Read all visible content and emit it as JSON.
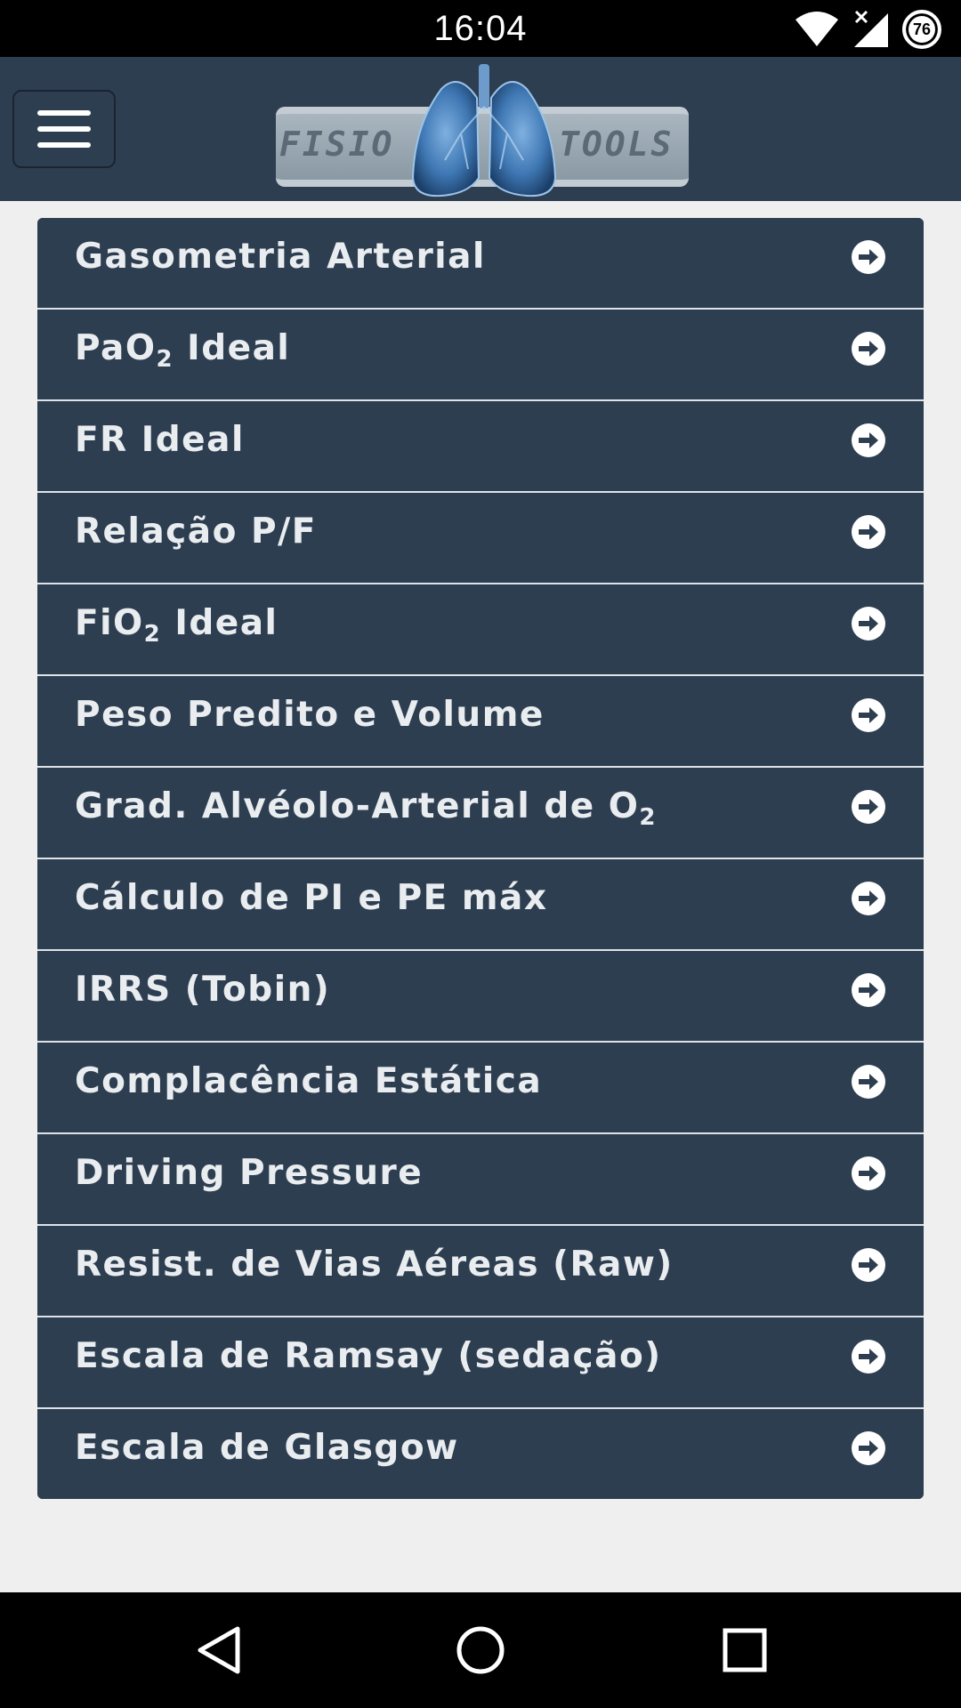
{
  "status_bar": {
    "time": "16:04",
    "battery_level": "76"
  },
  "header": {
    "logo_left": "FISIO",
    "logo_right": "TOOLS"
  },
  "menu": {
    "items": [
      {
        "label": "Gasometria Arterial",
        "sub": "",
        "suffix": ""
      },
      {
        "label": "PaO",
        "sub": "2",
        "suffix": " Ideal"
      },
      {
        "label": "FR Ideal",
        "sub": "",
        "suffix": ""
      },
      {
        "label": "Relação P/F",
        "sub": "",
        "suffix": ""
      },
      {
        "label": "FiO",
        "sub": "2",
        "suffix": " Ideal"
      },
      {
        "label": "Peso Predito e Volume",
        "sub": "",
        "suffix": ""
      },
      {
        "label": "Grad. Alvéolo-Arterial de O",
        "sub": "2",
        "suffix": ""
      },
      {
        "label": "Cálculo de PI e PE máx",
        "sub": "",
        "suffix": ""
      },
      {
        "label": "IRRS (Tobin)",
        "sub": "",
        "suffix": ""
      },
      {
        "label": "Complacência Estática",
        "sub": "",
        "suffix": ""
      },
      {
        "label": "Driving Pressure",
        "sub": "",
        "suffix": ""
      },
      {
        "label": "Resist. de Vias Aéreas (Raw)",
        "sub": "",
        "suffix": ""
      },
      {
        "label": "Escala de Ramsay (sedação)",
        "sub": "",
        "suffix": ""
      },
      {
        "label": "Escala de Glasgow",
        "sub": "",
        "suffix": ""
      }
    ]
  },
  "icons": {
    "menu": "hamburger-menu-icon",
    "item_arrow": "arrow-circle-right-icon",
    "wifi": "wifi-icon",
    "signal": "cell-signal-icon",
    "battery": "battery-icon",
    "back": "back-triangle-icon",
    "home": "home-circle-icon",
    "recent": "recent-apps-square-icon"
  },
  "colors": {
    "header_bg": "#2e3e51",
    "item_bg": "#2e3e51",
    "item_text": "#e9edf0",
    "page_bg": "#efefef",
    "divider": "#dfe3e7"
  }
}
